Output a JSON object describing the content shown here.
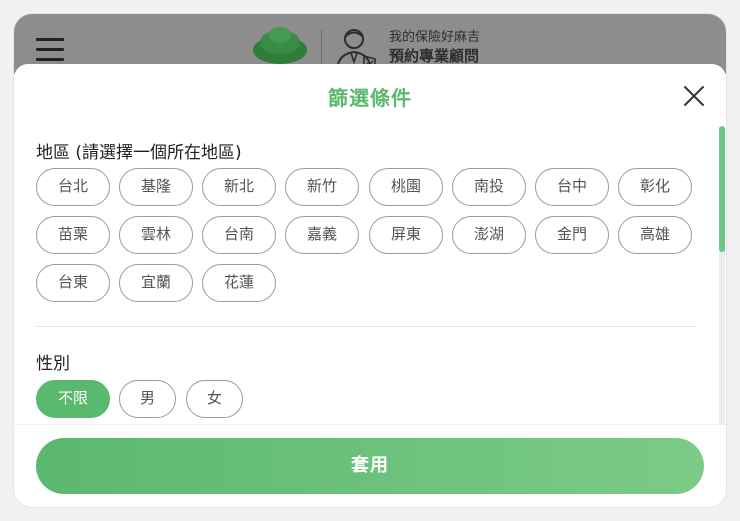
{
  "app_header": {
    "brand_line1": "我的保險好麻吉",
    "brand_line2": "預約專業顧問",
    "icons": [
      "menu-icon",
      "tree-logo",
      "advisor-icon"
    ]
  },
  "sheet": {
    "title": "篩選條件",
    "close_icon": "close-icon"
  },
  "filters": {
    "region": {
      "label": "地區 (請選擇一個所在地區)",
      "options": [
        "台北",
        "基隆",
        "新北",
        "新竹",
        "桃園",
        "南投",
        "台中",
        "彰化",
        "苗栗",
        "雲林",
        "台南",
        "嘉義",
        "屏東",
        "澎湖",
        "金門",
        "高雄",
        "台東",
        "宜蘭",
        "花蓮"
      ],
      "selected": null
    },
    "gender": {
      "label": "性別",
      "options": [
        "不限",
        "男",
        "女"
      ],
      "selected": "不限"
    }
  },
  "footer": {
    "apply_label": "套用"
  },
  "colors": {
    "accent": "#5bb86f",
    "header_overlay": "#8d8d8d",
    "chip_border": "#9b9b9b"
  }
}
